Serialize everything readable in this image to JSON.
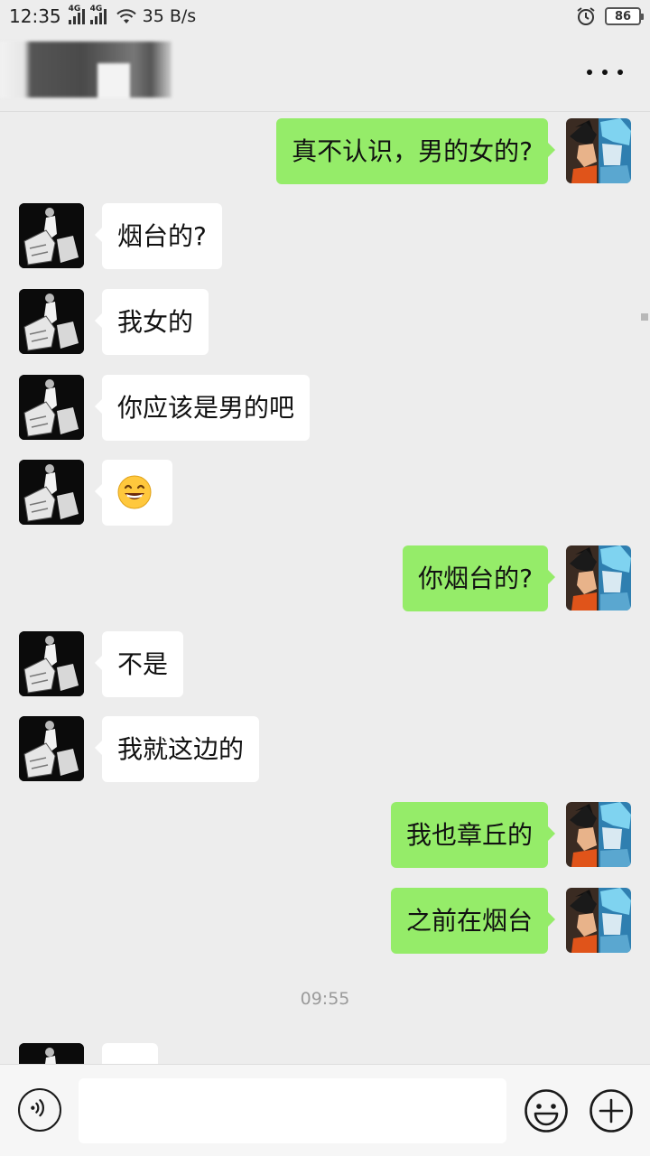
{
  "status_bar": {
    "time": "12:35",
    "signal1_label": "4G",
    "signal2_label": "4G",
    "net_speed": "35 B/s",
    "battery": "86"
  },
  "chat": {
    "messages": [
      {
        "side": "right",
        "text": "真不认识，男的女的?"
      },
      {
        "side": "left",
        "text": "烟台的?"
      },
      {
        "side": "left",
        "text": "我女的"
      },
      {
        "side": "left",
        "text": "你应该是男的吧"
      },
      {
        "side": "left",
        "emoji": "grinning-face"
      },
      {
        "side": "right",
        "text": "你烟台的?"
      },
      {
        "side": "left",
        "text": "不是"
      },
      {
        "side": "left",
        "text": "我就这边的"
      },
      {
        "side": "right",
        "text": "我也章丘的"
      },
      {
        "side": "right",
        "text": "之前在烟台"
      }
    ],
    "timestamp": "09:55"
  },
  "input": {
    "value": ""
  },
  "colors": {
    "sent_bubble": "#95ec69",
    "received_bubble": "#ffffff",
    "background": "#ededed"
  }
}
